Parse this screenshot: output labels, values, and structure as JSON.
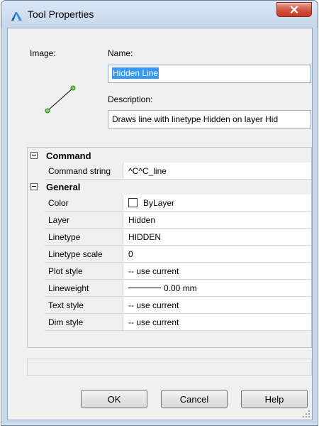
{
  "window": {
    "title": "Tool Properties",
    "close_label": "X",
    "icons": {
      "app": "autocad-logo-icon",
      "close": "close-icon"
    }
  },
  "form": {
    "image_label": "Image:",
    "image_icon": "line-tool-icon",
    "name_label": "Name:",
    "name_value": "Hidden Line",
    "description_label": "Description:",
    "description_value": "Draws line with linetype Hidden on layer Hid"
  },
  "properties": {
    "categories": [
      {
        "name": "Command",
        "rows": [
          {
            "name": "Command string",
            "value": "^C^C_line"
          }
        ]
      },
      {
        "name": "General",
        "rows": [
          {
            "name": "Color",
            "value": "ByLayer"
          },
          {
            "name": "Layer",
            "value": "Hidden"
          },
          {
            "name": "Linetype",
            "value": "HIDDEN"
          },
          {
            "name": "Linetype scale",
            "value": "0"
          },
          {
            "name": "Plot style",
            "value": "-- use current"
          },
          {
            "name": "Lineweight",
            "value": "0.00 mm"
          },
          {
            "name": "Text style",
            "value": "-- use current"
          },
          {
            "name": "Dim style",
            "value": "-- use current"
          }
        ]
      }
    ]
  },
  "buttons": {
    "ok": "OK",
    "cancel": "Cancel",
    "help": "Help"
  },
  "colors": {
    "selection": "#3399ff",
    "close_button": "#c43a25",
    "titlebar": "#c8d9ec"
  }
}
